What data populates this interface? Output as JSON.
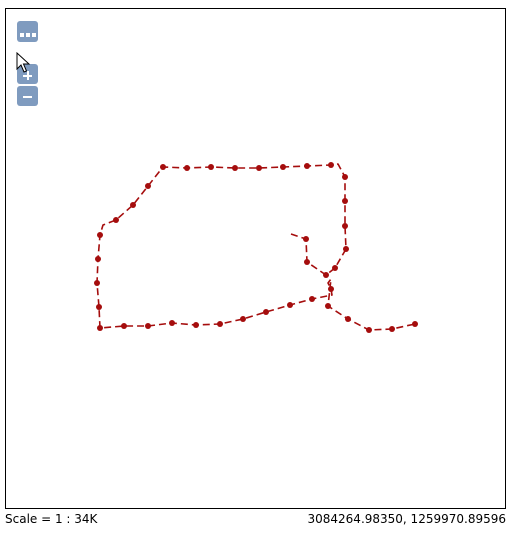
{
  "map": {
    "controls": {
      "layers_icon": "layers-switcher-icon",
      "zoom_in_icon": "plus-icon",
      "zoom_out_icon": "minus-icon",
      "color": "#7f9bbf"
    },
    "route": {
      "color": "#a50d0d",
      "line_style": "dashed"
    }
  },
  "footer": {
    "scale": "Scale = 1 : 34K",
    "coordinates": "3084264.98350, 1259970.89596"
  }
}
